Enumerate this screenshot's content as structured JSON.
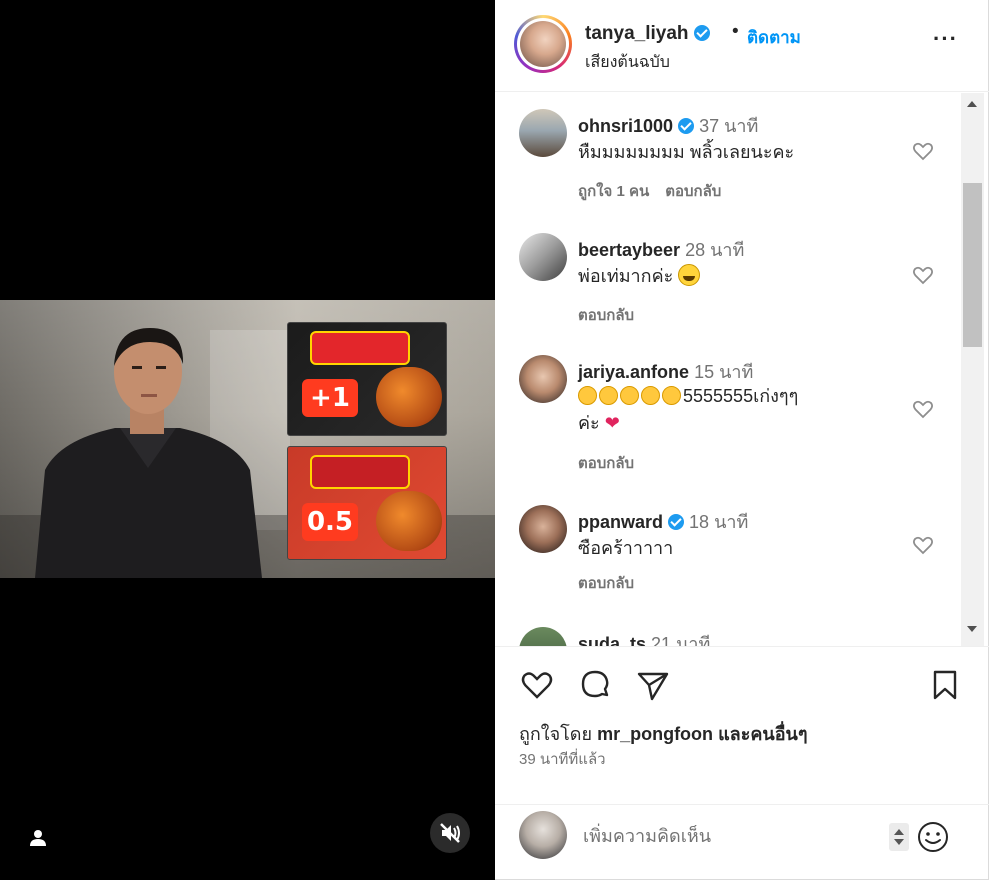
{
  "header": {
    "username": "tanya_liyah",
    "separator": "•",
    "follow_label": "ติดตาม",
    "subtitle": "เสียงต้นฉบับ",
    "more_label": "···"
  },
  "media": {
    "pack_top_badge": "+1",
    "pack_bottom_badge": "0.5"
  },
  "comments": [
    {
      "username": "ohnsri1000",
      "verified": true,
      "time": "37 นาที",
      "text": "หืมมมมมมมม พลิ้วเลยนะคะ",
      "likes": "ถูกใจ 1 คน",
      "reply": "ตอบกลับ"
    },
    {
      "username": "beertaybeer",
      "verified": false,
      "time": "28 นาที",
      "text": "พ่อเท่มากค่ะ",
      "reply": "ตอบกลับ"
    },
    {
      "username": "jariya.anfone",
      "verified": false,
      "time": "15 นาที",
      "text_after_claps": "5555555เก่งๆๆ",
      "text_line2": "ค่ะ",
      "reply": "ตอบกลับ"
    },
    {
      "username": "ppanward",
      "verified": true,
      "time": "18 นาที",
      "text": "ซือคร้าาาาา",
      "reply": "ตอบกลับ"
    },
    {
      "username": "suda_ts",
      "verified": false,
      "time": "21 นาที"
    }
  ],
  "likes": {
    "prefix": "ถูกใจโดย",
    "user": "mr_pongfoon",
    "suffix": "และคนอื่นๆ",
    "time_ago": "39 นาทีที่แล้ว"
  },
  "add_comment": {
    "placeholder": "เพิ่มความคิดเห็น"
  },
  "colors": {
    "accent": "#0095f6",
    "verified": "#1d9bf0",
    "muted_text": "#737373"
  }
}
